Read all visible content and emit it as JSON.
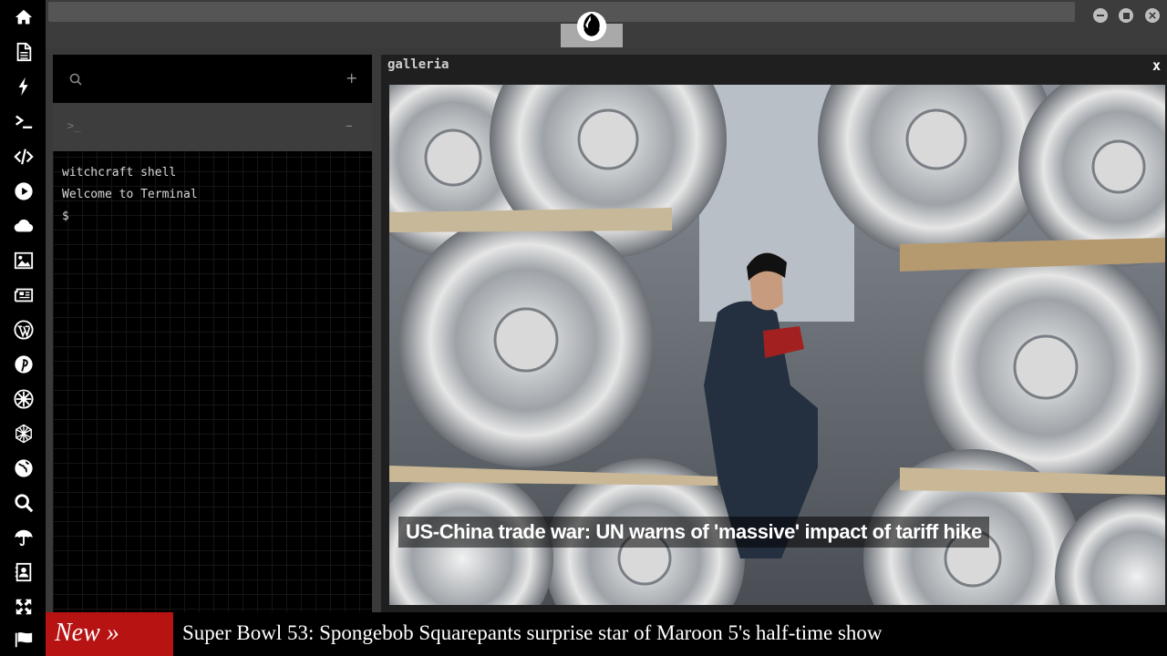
{
  "sidebar": {
    "items": [
      {
        "icon": "home-icon"
      },
      {
        "icon": "document-icon"
      },
      {
        "icon": "lightning-icon"
      },
      {
        "icon": "terminal-icon"
      },
      {
        "icon": "code-icon"
      },
      {
        "icon": "play-icon"
      },
      {
        "icon": "cloud-icon"
      },
      {
        "icon": "image-icon"
      },
      {
        "icon": "newspaper-icon"
      },
      {
        "icon": "wordpress-icon"
      },
      {
        "icon": "pinterest-icon"
      },
      {
        "icon": "empire-icon"
      },
      {
        "icon": "globe-mesh-icon"
      },
      {
        "icon": "world-icon"
      },
      {
        "icon": "search-icon"
      },
      {
        "icon": "umbrella-icon"
      },
      {
        "icon": "contacts-icon"
      },
      {
        "icon": "expand-icon"
      },
      {
        "icon": "flag-icon"
      }
    ]
  },
  "topbar": {
    "logo_icon": "rebel-alliance-icon",
    "window_buttons": [
      "minimize",
      "maximize",
      "close"
    ]
  },
  "terminal": {
    "search_icon": "search-icon",
    "add_label": "+",
    "prompt_icon": ">_",
    "collapse_label": "–",
    "lines": [
      "witchcraft shell",
      "Welcome to Terminal",
      "$"
    ]
  },
  "galleria": {
    "title": "galleria",
    "close_label": "x",
    "caption": "US-China trade war: UN warns of 'massive' impact of tariff hike"
  },
  "ticker": {
    "badge": "New »",
    "headline": "Super Bowl 53: Spongebob Squarepants surprise star of Maroon 5's half-time show"
  },
  "colors": {
    "accent_red": "#b71313",
    "sidebar_bg": "#000000",
    "panel_bg": "#1f1f1f",
    "terminal_bg": "#000000"
  }
}
